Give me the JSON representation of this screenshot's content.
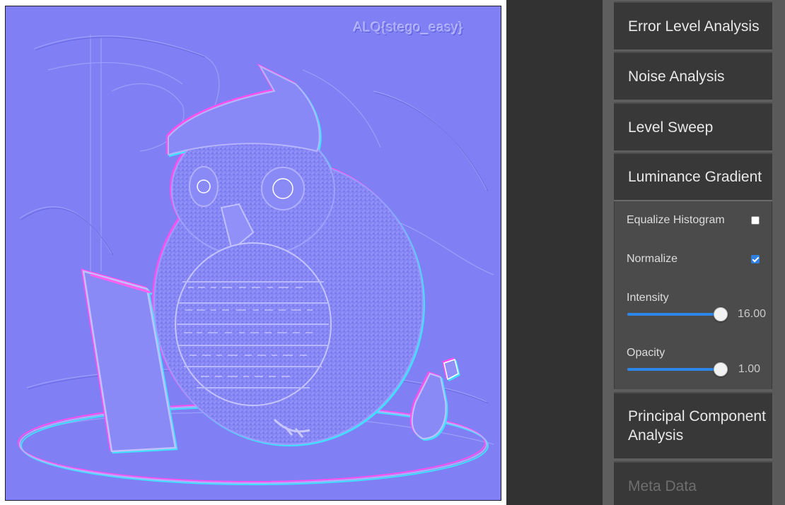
{
  "image": {
    "watermark": "ALQ{stego_easy}"
  },
  "sidebar": {
    "sections": [
      {
        "label": "Error Level Analysis"
      },
      {
        "label": "Noise Analysis"
      },
      {
        "label": "Level Sweep"
      },
      {
        "label": "Luminance Gradient",
        "expanded": true
      },
      {
        "label": "Principal Component Analysis"
      },
      {
        "label": "Meta Data",
        "disabled": true
      }
    ],
    "luminance": {
      "equalize_label": "Equalize Histogram",
      "equalize_checked": false,
      "normalize_label": "Normalize",
      "normalize_checked": true,
      "intensity_label": "Intensity",
      "intensity_value": "16.00",
      "intensity_fraction": 1.0,
      "opacity_label": "Opacity",
      "opacity_value": "1.00",
      "opacity_fraction": 1.0
    }
  },
  "colors": {
    "accent": "#2e86e8",
    "image_tint": "#8080f4"
  }
}
